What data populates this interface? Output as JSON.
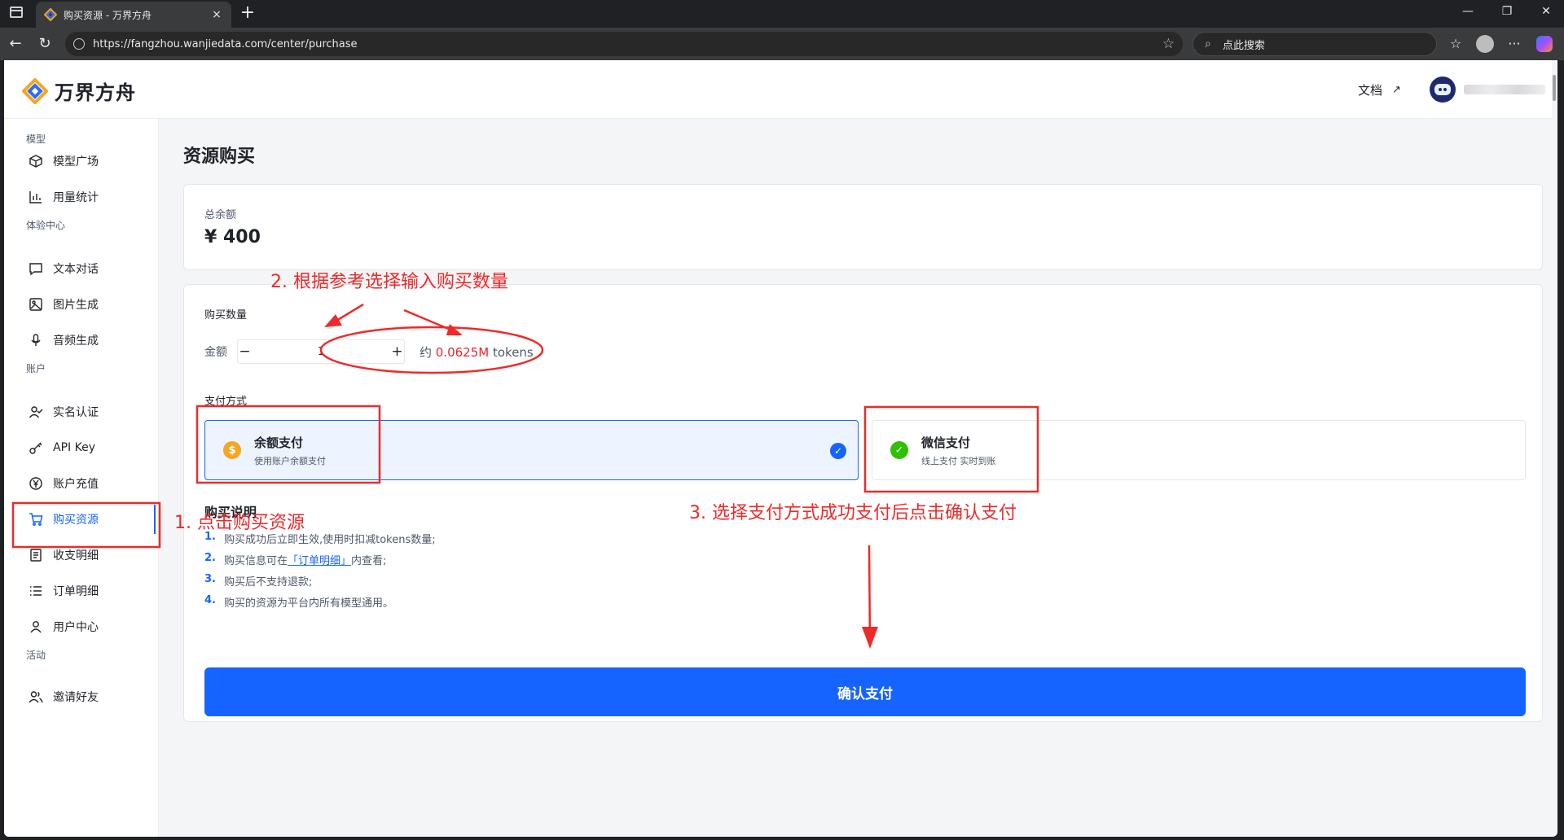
{
  "browser": {
    "tab_title": "购买资源 - 万界方舟",
    "tab_close": "×",
    "new_tab": "+",
    "url": "https://fangzhou.wanjiedata.com/center/purchase",
    "search_placeholder": "点此搜索",
    "back": "←",
    "reload": "↻",
    "star": "☆",
    "minimize": "—",
    "restore": "❐",
    "close": "✕",
    "more": "···",
    "favorites": "☆",
    "search_icon": "⌕"
  },
  "header": {
    "logo_text": "万界方舟",
    "docs_label": "文档",
    "docs_arrow": "↗"
  },
  "sidebar": {
    "groups": [
      {
        "label": "模型",
        "items": [
          {
            "label": "模型广场",
            "icon": "cube-icon"
          },
          {
            "label": "用量统计",
            "icon": "bar-chart-icon"
          }
        ]
      },
      {
        "label": "体验中心",
        "items": [
          {
            "label": "文本对话",
            "icon": "chat-icon"
          },
          {
            "label": "图片生成",
            "icon": "image-icon"
          },
          {
            "label": "音频生成",
            "icon": "mic-icon"
          }
        ]
      },
      {
        "label": "账户",
        "items": [
          {
            "label": "实名认证",
            "icon": "user-check-icon"
          },
          {
            "label": "API Key",
            "icon": "key-icon"
          },
          {
            "label": "账户充值",
            "icon": "yen-icon"
          },
          {
            "label": "购买资源",
            "icon": "cart-icon"
          },
          {
            "label": "收支明细",
            "icon": "document-icon"
          },
          {
            "label": "订单明细",
            "icon": "list-icon"
          },
          {
            "label": "用户中心",
            "icon": "user-icon"
          }
        ]
      },
      {
        "label": "活动",
        "items": [
          {
            "label": "邀请好友",
            "icon": "users-icon"
          }
        ]
      }
    ],
    "active": "购买资源"
  },
  "main": {
    "title": "资源购买",
    "balance": {
      "label": "总余额",
      "value": "¥ 400"
    },
    "purchase": {
      "quantity_label": "购买数量",
      "amount_label": "金额",
      "minus": "−",
      "plus": "+",
      "amount_value": "1",
      "tokens_prefix": "约 ",
      "tokens_value": "0.0625M",
      "tokens_suffix": " tokens",
      "payment_label": "支付方式",
      "payment_options": [
        {
          "title": "余额支付",
          "desc": "使用账户余额支付",
          "icon_glyph": "$",
          "selected": true
        },
        {
          "title": "微信支付",
          "desc": "线上支付 实时到账",
          "icon_glyph": "✓",
          "selected": false
        }
      ],
      "check_glyph": "✓",
      "notes_title": "购买说明",
      "notes": [
        {
          "num": "1.",
          "text": "购买成功后立即生效,使用时扣减tokens数量;"
        },
        {
          "num": "2.",
          "before": "购买信息可在",
          "link": "「订单明细」",
          "after": "内查看;"
        },
        {
          "num": "3.",
          "text": "购买后不支持退款;"
        },
        {
          "num": "4.",
          "text": "购买的资源为平台内所有模型通用。"
        }
      ],
      "confirm_label": "确认支付"
    }
  },
  "annotations": {
    "step1": "1. 点击购买资源",
    "step2": "2. 根据参考选择输入购买数量",
    "step3": "3. 选择支付方式成功支付后点击确认支付",
    "color": "#ee2a2a"
  }
}
